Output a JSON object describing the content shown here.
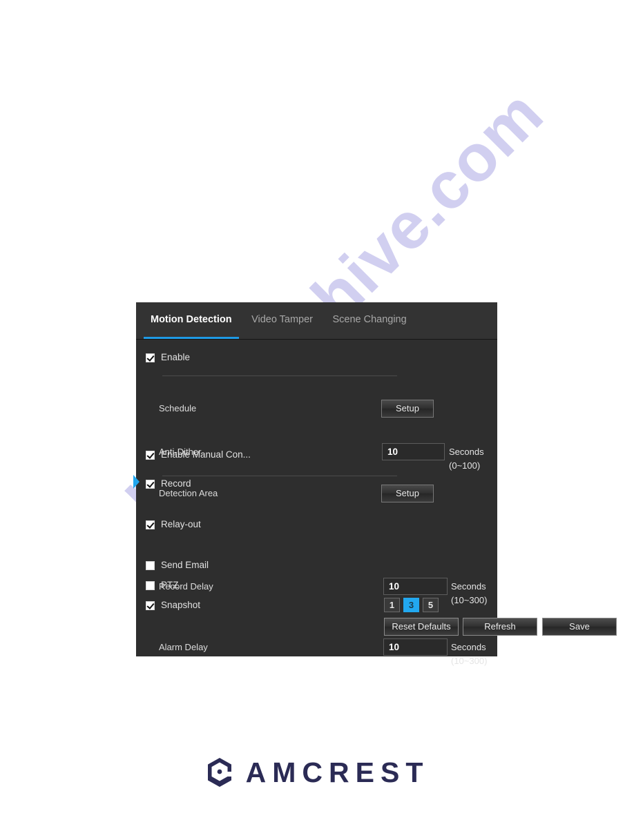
{
  "watermark": {
    "text": "manualshive.com"
  },
  "panel": {
    "tabs": [
      {
        "label": "Motion Detection",
        "active": true
      },
      {
        "label": "Video Tamper",
        "active": false
      },
      {
        "label": "Scene Changing",
        "active": false
      }
    ],
    "enable": {
      "label": "Enable",
      "checked": true
    },
    "schedule": {
      "label": "Schedule",
      "button": "Setup"
    },
    "anti_dither": {
      "label": "Anti-Dither",
      "value": "10",
      "unit": "Seconds (0~100)"
    },
    "detection_area": {
      "label": "Detection Area",
      "button": "Setup"
    },
    "manual_control": {
      "label": "Enable Manual Con...",
      "checked": true
    },
    "record": {
      "label": "Record",
      "checked": true
    },
    "record_delay": {
      "label": "Record Delay",
      "value": "10",
      "unit": "Seconds (10~300)"
    },
    "relay_out": {
      "label": "Relay-out",
      "checked": true
    },
    "alarm_delay": {
      "label": "Alarm Delay",
      "value": "10",
      "unit": "Seconds (10~300)"
    },
    "send_email": {
      "label": "Send Email",
      "checked": false
    },
    "ptz": {
      "label": "PTZ",
      "checked": false
    },
    "snapshot": {
      "label": "Snapshot",
      "checked": true,
      "options": [
        "1",
        "3",
        "5"
      ],
      "selected": "3"
    },
    "actions": {
      "reset": "Reset Defaults",
      "refresh": "Refresh",
      "save": "Save"
    },
    "colors": {
      "accent": "#1e9ae5",
      "panel_bg": "#2e2e2e",
      "header_bg": "#333333"
    }
  },
  "brand": {
    "name": "AMCREST",
    "color": "#2b2b55",
    "accent": "#38a8e0"
  }
}
